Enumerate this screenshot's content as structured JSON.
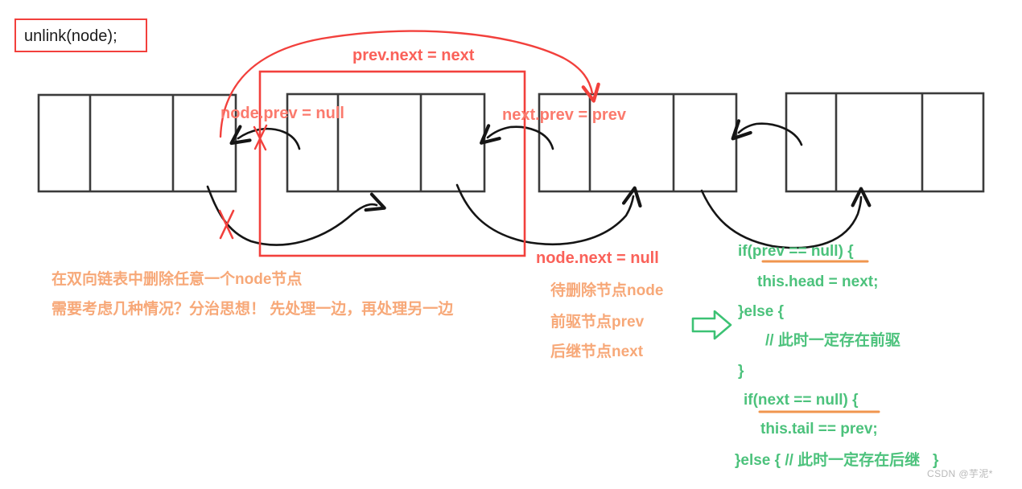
{
  "title_box": {
    "label": "unlink(node);",
    "border_color": "#f2403c"
  },
  "colors": {
    "red": "#fa6159",
    "red_box": "#f2403c",
    "orange": "#f7a878",
    "green": "#4cc27c",
    "node_stroke": "#3b3b3b",
    "watermark": "#b9b9b9"
  },
  "nodes": [
    {
      "name": "prev-node",
      "cells": 3
    },
    {
      "name": "node-to-delete",
      "cells": 3
    },
    {
      "name": "next-node",
      "cells": 3
    },
    {
      "name": "tail-node",
      "cells": 3
    }
  ],
  "red_annotations": [
    {
      "id": "prev_next",
      "text": "prev.next = next"
    },
    {
      "id": "node_prev",
      "text": "node.prev = null"
    },
    {
      "id": "next_prev",
      "text": "next.prev = prev"
    },
    {
      "id": "node_next",
      "text": "node.next = null"
    }
  ],
  "orange_notes_left": [
    "在双向链表中删除任意一个node节点",
    "需要考虑几种情况？分治思想！ 先处理一边，再处理另一边"
  ],
  "orange_notes_mid": [
    "待删除节点node",
    "前驱节点prev",
    "后继节点next"
  ],
  "green_code_lines": [
    "if(prev == null) {",
    "this.head = next;",
    "}else {",
    "// 此时一定存在前驱",
    "}",
    "if(next == null) {",
    "this.tail == prev;",
    "}else { // 此时一定存在后继   }"
  ],
  "watermark": "CSDN @芋泥*"
}
